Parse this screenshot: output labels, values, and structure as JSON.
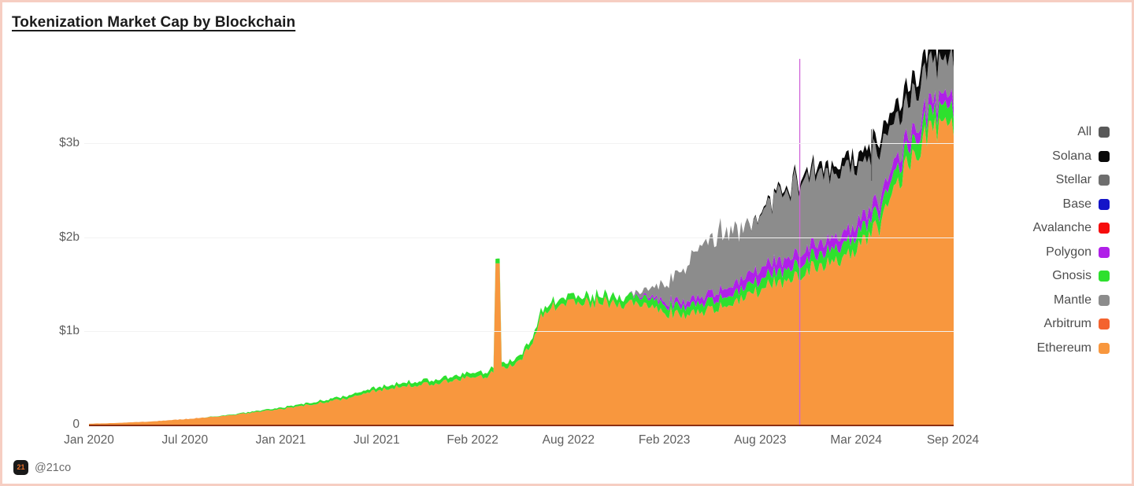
{
  "page": {
    "border_color": "#f6cec2",
    "background": "#ffffff"
  },
  "header": {
    "title": "Tokenization Market Cap by Blockchain"
  },
  "footer": {
    "logo_text": "21",
    "handle": "@21co"
  },
  "legend": {
    "position": "right",
    "items": [
      {
        "label": "All",
        "color": "#595959"
      },
      {
        "label": "Solana",
        "color": "#0a0a0a"
      },
      {
        "label": "Stellar",
        "color": "#6e6e6e"
      },
      {
        "label": "Base",
        "color": "#1414c8"
      },
      {
        "label": "Avalanche",
        "color": "#f60c0c"
      },
      {
        "label": "Polygon",
        "color": "#b020e8"
      },
      {
        "label": "Gnosis",
        "color": "#2ee02e"
      },
      {
        "label": "Mantle",
        "color": "#8c8c8c"
      },
      {
        "label": "Arbitrum",
        "color": "#f4632e"
      },
      {
        "label": "Ethereum",
        "color": "#f8973e"
      }
    ]
  },
  "chart_data": {
    "type": "area",
    "stacked": true,
    "title": "Tokenization Market Cap by Blockchain",
    "xlabel": "",
    "ylabel": "",
    "grid": true,
    "ylim": [
      0,
      4000000000
    ],
    "y_ticks": [
      {
        "value": 0,
        "label": "0"
      },
      {
        "value": 1000000000,
        "label": "$1b"
      },
      {
        "value": 2000000000,
        "label": "$2b"
      },
      {
        "value": 3000000000,
        "label": "$3b"
      }
    ],
    "x_ticks": [
      {
        "label": "Jan 2020",
        "pos": 0.0
      },
      {
        "label": "Jul 2020",
        "pos": 0.111
      },
      {
        "label": "Jan 2021",
        "pos": 0.222
      },
      {
        "label": "Jul 2021",
        "pos": 0.333
      },
      {
        "label": "Feb 2022",
        "pos": 0.444
      },
      {
        "label": "Aug 2022",
        "pos": 0.555
      },
      {
        "label": "Feb 2023",
        "pos": 0.666
      },
      {
        "label": "Aug 2023",
        "pos": 0.777
      },
      {
        "label": "Mar 2024",
        "pos": 0.888
      },
      {
        "label": "Sep 2024",
        "pos": 1.0
      }
    ],
    "x_range": [
      "Jan 2020",
      "Sep 2024"
    ],
    "annotations": [
      {
        "type": "spike",
        "series": "Polygon",
        "x_pos": 0.822,
        "value": 3900000000,
        "note": "thin magenta spike"
      },
      {
        "type": "spike",
        "series": "Ethereum",
        "x_pos": 0.472,
        "value": 1720000000,
        "note": "orange spike near Feb 2022"
      },
      {
        "type": "spike",
        "series": "Gnosis",
        "x_pos": 0.472,
        "value": 1740000000,
        "note": "green tip on Feb 2022 spike"
      }
    ],
    "series": [
      {
        "name": "Ethereum",
        "color": "#f8973e",
        "values_b": [
          0.01,
          0.012,
          0.013,
          0.014,
          0.016,
          0.018,
          0.02,
          0.022,
          0.025,
          0.028,
          0.03,
          0.033,
          0.036,
          0.04,
          0.044,
          0.048,
          0.052,
          0.056,
          0.06,
          0.065,
          0.07,
          0.075,
          0.08,
          0.085,
          0.09,
          0.095,
          0.1,
          0.105,
          0.112,
          0.118,
          0.125,
          0.132,
          0.14,
          0.148,
          0.155,
          0.162,
          0.17,
          0.178,
          0.185,
          0.195,
          0.205,
          0.215,
          0.225,
          0.235,
          0.245,
          0.255,
          0.265,
          0.275,
          0.285,
          0.3,
          0.315,
          0.33,
          0.345,
          0.36,
          0.37,
          0.38,
          0.39,
          0.4,
          0.41,
          0.415,
          0.42,
          0.425,
          0.43,
          0.435,
          0.44,
          0.45,
          0.46,
          0.47,
          0.48,
          0.49,
          0.5,
          0.505,
          0.51,
          0.515,
          0.52,
          0.58,
          0.6,
          0.62,
          0.64,
          0.66,
          0.7,
          0.78,
          0.9,
          1.05,
          1.2,
          1.25,
          1.28,
          1.3,
          1.31,
          1.32,
          1.33,
          1.32,
          1.3,
          1.29,
          1.3,
          1.31,
          1.3,
          1.28,
          1.27,
          1.26,
          1.27,
          1.28,
          1.26,
          1.24,
          1.23,
          1.22,
          1.21,
          1.2,
          1.19,
          1.18,
          1.17,
          1.18,
          1.19,
          1.2,
          1.21,
          1.22,
          1.23,
          1.25,
          1.27,
          1.3,
          1.33,
          1.36,
          1.38,
          1.4,
          1.42,
          1.45,
          1.48,
          1.5,
          1.52,
          1.55,
          1.58,
          1.6,
          1.62,
          1.65,
          1.68,
          1.7,
          1.72,
          1.74,
          1.75,
          1.77,
          1.8,
          1.85,
          1.9,
          1.95,
          2.0,
          2.05,
          2.1,
          2.2,
          2.35,
          2.5,
          2.65,
          2.75,
          2.85,
          2.95,
          3.0,
          3.05,
          3.1,
          3.12,
          3.15,
          3.18,
          3.2
        ]
      },
      {
        "name": "Gnosis",
        "color": "#2ee02e",
        "values_b": [
          0,
          0,
          0,
          0,
          0,
          0,
          0,
          0,
          0,
          0,
          0,
          0,
          0,
          0,
          0,
          0,
          0,
          0,
          0,
          0,
          0,
          0,
          0.002,
          0.003,
          0.004,
          0.005,
          0.006,
          0.007,
          0.008,
          0.009,
          0.01,
          0.011,
          0.012,
          0.013,
          0.014,
          0.015,
          0.016,
          0.017,
          0.018,
          0.019,
          0.02,
          0.021,
          0.022,
          0.023,
          0.024,
          0.025,
          0.026,
          0.027,
          0.028,
          0.029,
          0.03,
          0.031,
          0.032,
          0.033,
          0.034,
          0.035,
          0.036,
          0.037,
          0.038,
          0.039,
          0.04,
          0.04,
          0.041,
          0.041,
          0.042,
          0.043,
          0.043,
          0.044,
          0.045,
          0.046,
          0.046,
          0.047,
          0.048,
          0.048,
          0.049,
          0.05,
          0.05,
          0.051,
          0.052,
          0.053,
          0.054,
          0.055,
          0.056,
          0.057,
          0.058,
          0.06,
          0.062,
          0.064,
          0.065,
          0.066,
          0.068,
          0.07,
          0.072,
          0.073,
          0.074,
          0.075,
          0.076,
          0.077,
          0.078,
          0.079,
          0.08,
          0.081,
          0.082,
          0.083,
          0.084,
          0.085,
          0.086,
          0.087,
          0.088,
          0.089,
          0.09,
          0.091,
          0.092,
          0.093,
          0.094,
          0.095,
          0.096,
          0.097,
          0.098,
          0.1,
          0.102,
          0.104,
          0.106,
          0.108,
          0.11,
          0.112,
          0.114,
          0.116,
          0.118,
          0.12,
          0.122,
          0.124,
          0.126,
          0.128,
          0.13,
          0.132,
          0.134,
          0.136,
          0.138,
          0.14,
          0.142,
          0.144,
          0.146,
          0.148,
          0.15,
          0.152,
          0.154,
          0.156,
          0.158,
          0.16,
          0.162,
          0.164,
          0.166,
          0.168,
          0.17,
          0.172,
          0.174,
          0.176,
          0.178,
          0.18,
          0.182
        ]
      },
      {
        "name": "Polygon",
        "color": "#b020e8",
        "values_b": [
          0,
          0,
          0,
          0,
          0,
          0,
          0,
          0,
          0,
          0,
          0,
          0,
          0,
          0,
          0,
          0,
          0,
          0,
          0,
          0,
          0,
          0,
          0,
          0,
          0,
          0,
          0,
          0,
          0,
          0,
          0,
          0,
          0,
          0,
          0,
          0,
          0,
          0,
          0,
          0,
          0,
          0,
          0,
          0,
          0,
          0,
          0,
          0,
          0,
          0,
          0,
          0,
          0,
          0,
          0,
          0,
          0,
          0,
          0,
          0,
          0,
          0,
          0,
          0,
          0,
          0,
          0,
          0,
          0,
          0,
          0,
          0,
          0,
          0,
          0,
          0,
          0,
          0,
          0,
          0,
          0,
          0,
          0,
          0,
          0,
          0,
          0,
          0,
          0,
          0,
          0,
          0,
          0,
          0,
          0,
          0,
          0,
          0,
          0,
          0,
          0,
          0.01,
          0.015,
          0.02,
          0.025,
          0.03,
          0.035,
          0.04,
          0.045,
          0.05,
          0.055,
          0.06,
          0.065,
          0.07,
          0.075,
          0.08,
          0.085,
          0.09,
          0.095,
          0.1,
          0.105,
          0.11,
          0.115,
          0.12,
          0.12,
          0.12,
          0.12,
          0.12,
          0.12,
          0.12,
          0.12,
          0.12,
          0.12,
          0.12,
          0.12,
          0.12,
          0.12,
          0.12,
          0.12,
          0.12,
          0.12,
          0.12,
          0.12,
          0.12,
          0.12,
          0.12,
          0.12,
          0.12,
          0.12,
          0.12,
          0.12,
          0.12,
          0.12,
          0.12,
          0.12,
          0.12,
          0.12,
          0.12,
          0.12,
          0.12,
          0.12
        ]
      },
      {
        "name": "Stellar",
        "color": "#8c8c8c",
        "values_b": [
          0,
          0,
          0,
          0,
          0,
          0,
          0,
          0,
          0,
          0,
          0,
          0,
          0,
          0,
          0,
          0,
          0,
          0,
          0,
          0,
          0,
          0,
          0,
          0,
          0,
          0,
          0,
          0,
          0,
          0,
          0,
          0,
          0,
          0,
          0,
          0,
          0,
          0,
          0,
          0,
          0,
          0,
          0,
          0,
          0,
          0,
          0,
          0,
          0,
          0,
          0,
          0,
          0,
          0,
          0,
          0,
          0,
          0,
          0,
          0,
          0,
          0,
          0,
          0,
          0,
          0,
          0,
          0,
          0,
          0,
          0,
          0,
          0,
          0,
          0,
          0,
          0,
          0,
          0,
          0,
          0,
          0,
          0,
          0,
          0,
          0,
          0,
          0,
          0,
          0,
          0,
          0,
          0,
          0,
          0,
          0,
          0,
          0,
          0,
          0,
          0,
          0.02,
          0.04,
          0.06,
          0.09,
          0.12,
          0.16,
          0.2,
          0.25,
          0.3,
          0.35,
          0.4,
          0.45,
          0.5,
          0.55,
          0.58,
          0.6,
          0.62,
          0.6,
          0.58,
          0.56,
          0.54,
          0.52,
          0.5,
          0.52,
          0.55,
          0.6,
          0.65,
          0.7,
          0.72,
          0.74,
          0.75,
          0.74,
          0.73,
          0.72,
          0.71,
          0.7,
          0.69,
          0.68,
          0.67,
          0.66,
          0.64,
          0.62,
          0.6,
          0.58,
          0.56,
          0.54,
          0.5,
          0.46,
          0.42,
          0.4,
          0.4,
          0.4,
          0.4,
          0.4,
          0.4,
          0.4,
          0.4,
          0.4,
          0.4,
          0.4
        ]
      },
      {
        "name": "Solana",
        "color": "#0a0a0a",
        "values_b": [
          0,
          0,
          0,
          0,
          0,
          0,
          0,
          0,
          0,
          0,
          0,
          0,
          0,
          0,
          0,
          0,
          0,
          0,
          0,
          0,
          0,
          0,
          0,
          0,
          0,
          0,
          0,
          0,
          0,
          0,
          0,
          0,
          0,
          0,
          0,
          0,
          0,
          0,
          0,
          0,
          0,
          0,
          0,
          0,
          0,
          0,
          0,
          0,
          0,
          0,
          0,
          0,
          0,
          0,
          0,
          0,
          0,
          0,
          0,
          0,
          0,
          0,
          0,
          0,
          0,
          0,
          0,
          0,
          0,
          0,
          0,
          0,
          0,
          0,
          0,
          0,
          0,
          0,
          0,
          0,
          0,
          0,
          0,
          0,
          0,
          0,
          0,
          0,
          0,
          0,
          0,
          0,
          0,
          0,
          0,
          0,
          0,
          0,
          0,
          0,
          0,
          0,
          0,
          0,
          0,
          0,
          0,
          0,
          0,
          0,
          0,
          0,
          0,
          0,
          0,
          0,
          0,
          0,
          0,
          0,
          0,
          0,
          0.005,
          0.01,
          0.015,
          0.02,
          0.025,
          0.03,
          0.035,
          0.04,
          0.045,
          0.05,
          0.055,
          0.06,
          0.065,
          0.07,
          0.075,
          0.08,
          0.085,
          0.09,
          0.095,
          0.1,
          0.105,
          0.11,
          0.115,
          0.12,
          0.125,
          0.13,
          0.135,
          0.14,
          0.145,
          0.15,
          0.155,
          0.16,
          0.165,
          0.17,
          0.175,
          0.18,
          0.185,
          0.19,
          0.2
        ]
      }
    ]
  }
}
